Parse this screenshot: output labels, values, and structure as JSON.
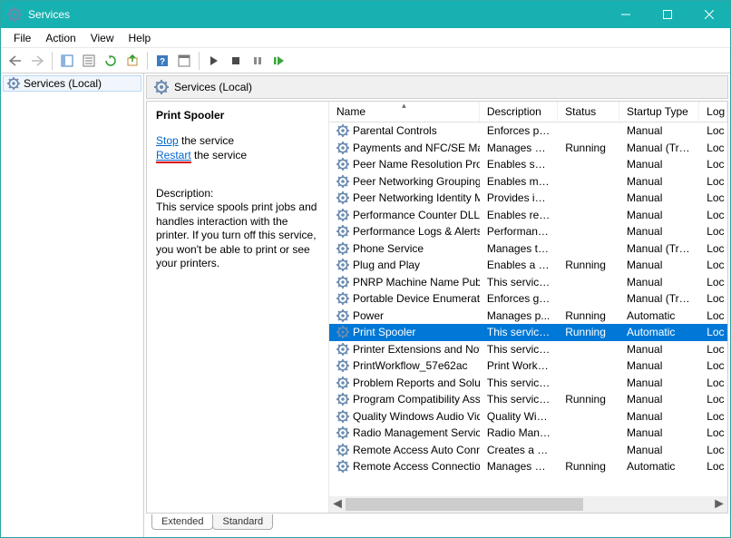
{
  "window": {
    "title": "Services"
  },
  "menu": {
    "items": [
      "File",
      "Action",
      "View",
      "Help"
    ]
  },
  "left": {
    "item": "Services (Local)"
  },
  "header": {
    "label": "Services (Local)"
  },
  "detail": {
    "selected_name": "Print Spooler",
    "stop_text": "Stop",
    "stop_suffix": " the service",
    "restart_text": "Restart",
    "restart_suffix": " the service",
    "desc_label": "Description:",
    "desc_text": "This service spools print jobs and handles interaction with the printer. If you turn off this service, you won't be able to print or see your printers."
  },
  "columns": {
    "name": "Name",
    "desc": "Description",
    "status": "Status",
    "startup": "Startup Type",
    "logon": "Log On As"
  },
  "rows": [
    {
      "name": "Parental Controls",
      "desc": "Enforces pa...",
      "status": "",
      "startup": "Manual",
      "logon": "Loc"
    },
    {
      "name": "Payments and NFC/SE Man...",
      "desc": "Manages pa...",
      "status": "Running",
      "startup": "Manual (Trig...",
      "logon": "Loc"
    },
    {
      "name": "Peer Name Resolution Prot...",
      "desc": "Enables serv...",
      "status": "",
      "startup": "Manual",
      "logon": "Loc"
    },
    {
      "name": "Peer Networking Grouping",
      "desc": "Enables mul...",
      "status": "",
      "startup": "Manual",
      "logon": "Loc"
    },
    {
      "name": "Peer Networking Identity M...",
      "desc": "Provides ide...",
      "status": "",
      "startup": "Manual",
      "logon": "Loc"
    },
    {
      "name": "Performance Counter DLL ...",
      "desc": "Enables rem...",
      "status": "",
      "startup": "Manual",
      "logon": "Loc"
    },
    {
      "name": "Performance Logs & Alerts",
      "desc": "Performanc...",
      "status": "",
      "startup": "Manual",
      "logon": "Loc"
    },
    {
      "name": "Phone Service",
      "desc": "Manages th...",
      "status": "",
      "startup": "Manual (Trig...",
      "logon": "Loc"
    },
    {
      "name": "Plug and Play",
      "desc": "Enables a c...",
      "status": "Running",
      "startup": "Manual",
      "logon": "Loc"
    },
    {
      "name": "PNRP Machine Name Publi...",
      "desc": "This service ...",
      "status": "",
      "startup": "Manual",
      "logon": "Loc"
    },
    {
      "name": "Portable Device Enumerator...",
      "desc": "Enforces gr...",
      "status": "",
      "startup": "Manual (Trig...",
      "logon": "Loc"
    },
    {
      "name": "Power",
      "desc": "Manages p...",
      "status": "Running",
      "startup": "Automatic",
      "logon": "Loc"
    },
    {
      "name": "Print Spooler",
      "desc": "This service ...",
      "status": "Running",
      "startup": "Automatic",
      "logon": "Loc",
      "selected": true
    },
    {
      "name": "Printer Extensions and Notif...",
      "desc": "This service ...",
      "status": "",
      "startup": "Manual",
      "logon": "Loc"
    },
    {
      "name": "PrintWorkflow_57e62ac",
      "desc": "Print Workfl...",
      "status": "",
      "startup": "Manual",
      "logon": "Loc"
    },
    {
      "name": "Problem Reports and Soluti...",
      "desc": "This service ...",
      "status": "",
      "startup": "Manual",
      "logon": "Loc"
    },
    {
      "name": "Program Compatibility Assi...",
      "desc": "This service ...",
      "status": "Running",
      "startup": "Manual",
      "logon": "Loc"
    },
    {
      "name": "Quality Windows Audio Vid...",
      "desc": "Quality Win...",
      "status": "",
      "startup": "Manual",
      "logon": "Loc"
    },
    {
      "name": "Radio Management Service",
      "desc": "Radio Mana...",
      "status": "",
      "startup": "Manual",
      "logon": "Loc"
    },
    {
      "name": "Remote Access Auto Conne...",
      "desc": "Creates a co...",
      "status": "",
      "startup": "Manual",
      "logon": "Loc"
    },
    {
      "name": "Remote Access Connection...",
      "desc": "Manages di...",
      "status": "Running",
      "startup": "Automatic",
      "logon": "Loc"
    }
  ],
  "tabs": {
    "extended": "Extended",
    "standard": "Standard"
  }
}
